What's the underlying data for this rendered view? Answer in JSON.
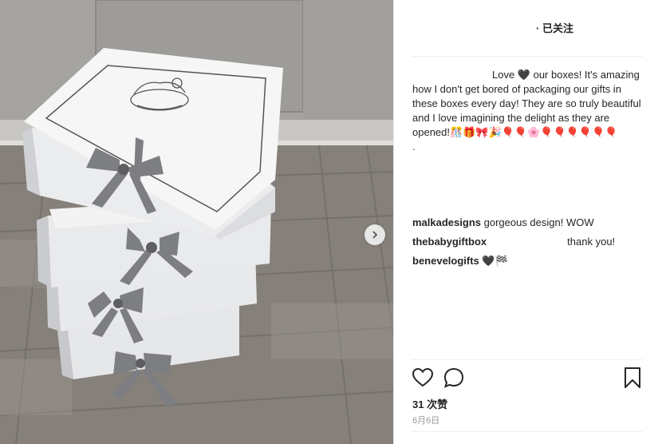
{
  "post": {
    "follow_label": "· 已关注",
    "caption_text": "Love 🖤 our boxes! It's amazing how I don't get bored of packaging our gifts in these boxes every day! They are so truly beautiful and I love imagining the delight as they are opened!🎊🎁🎀🎉🎈🎈🌸🎈🎈🎈🎈🎈🎈",
    "caption_tail": "."
  },
  "comments": [
    {
      "user": "malkadesigns",
      "text": " gorgeous design! WOW"
    },
    {
      "user": "thebabygiftbox",
      "text": "thank you!"
    },
    {
      "user": "benevelogifts",
      "text": " 🖤🏁"
    }
  ],
  "stats": {
    "likes_label": "31 次赞",
    "date_label": "6月6日"
  },
  "icons": [
    "heart-icon",
    "comment-icon",
    "bookmark-icon",
    "chevron-right-icon"
  ]
}
